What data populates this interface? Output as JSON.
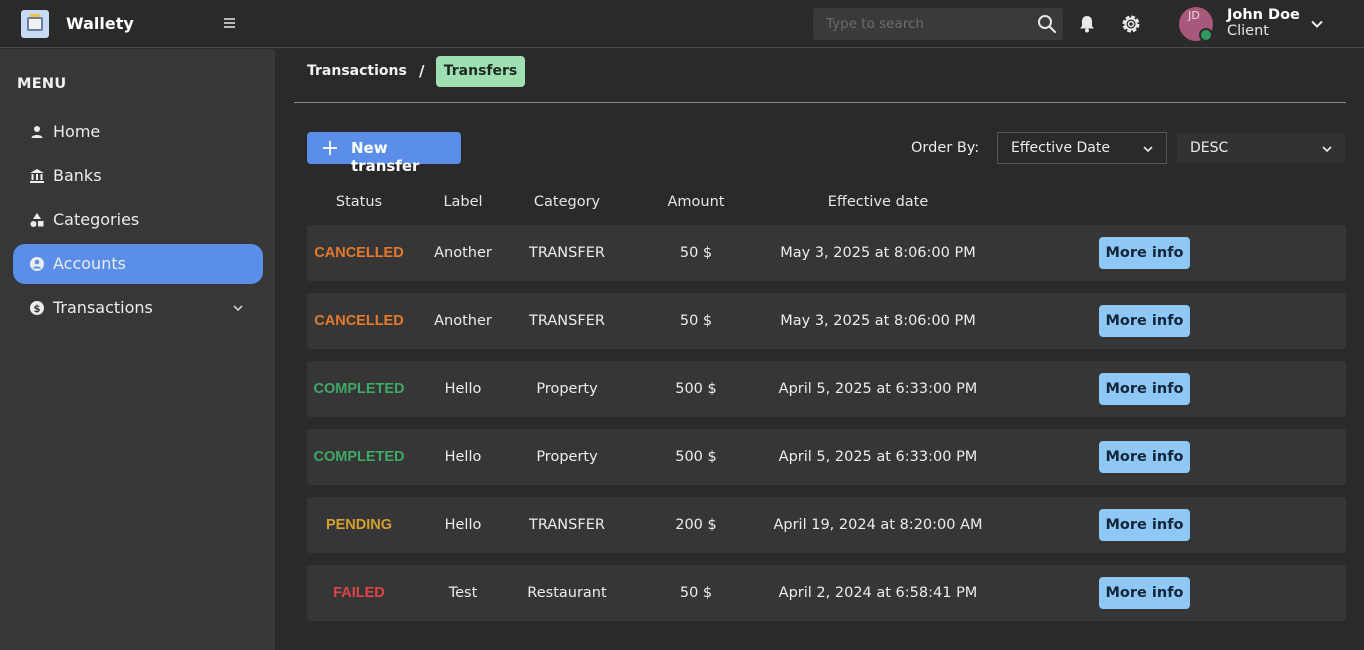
{
  "app": {
    "title": "Wallety"
  },
  "search": {
    "placeholder": "Type to search"
  },
  "user": {
    "initials": "JD",
    "name": "John Doe",
    "role": "Client"
  },
  "sidebar": {
    "header": "MENU",
    "items": [
      {
        "label": "Home",
        "icon": "person-icon",
        "active": false
      },
      {
        "label": "Banks",
        "icon": "bank-icon",
        "active": false
      },
      {
        "label": "Categories",
        "icon": "shapes-icon",
        "active": false
      },
      {
        "label": "Accounts",
        "icon": "account-circle-icon",
        "active": true
      },
      {
        "label": "Transactions",
        "icon": "dollar-circle-icon",
        "active": false,
        "expandable": true
      }
    ]
  },
  "breadcrumb": {
    "parent": "Transactions",
    "separator": "/",
    "current": "Transfers"
  },
  "toolbar": {
    "new_button": "New transfer",
    "order_by_label": "Order By:",
    "order_field": "Effective Date",
    "order_direction": "DESC"
  },
  "table": {
    "columns": [
      "Status",
      "Label",
      "Category",
      "Amount",
      "Effective date"
    ],
    "action_label": "More info",
    "rows": [
      {
        "status": "CANCELLED",
        "label": "Another",
        "category": "TRANSFER",
        "amount": "50 $",
        "date": "May 3, 2025 at 8:06:00 PM"
      },
      {
        "status": "CANCELLED",
        "label": "Another",
        "category": "TRANSFER",
        "amount": "50 $",
        "date": "May 3, 2025 at 8:06:00 PM"
      },
      {
        "status": "COMPLETED",
        "label": "Hello",
        "category": "Property",
        "amount": "500 $",
        "date": "April 5, 2025 at 6:33:00 PM"
      },
      {
        "status": "COMPLETED",
        "label": "Hello",
        "category": "Property",
        "amount": "500 $",
        "date": "April 5, 2025 at 6:33:00 PM"
      },
      {
        "status": "PENDING",
        "label": "Hello",
        "category": "TRANSFER",
        "amount": "200 $",
        "date": "April 19, 2024 at 8:20:00 AM"
      },
      {
        "status": "FAILED",
        "label": "Test",
        "category": "Restaurant",
        "amount": "50 $",
        "date": "April 2, 2024 at 6:58:41 PM"
      }
    ]
  },
  "colors": {
    "accent": "#5b8ee8",
    "status_cancelled": "#e57a2e",
    "status_completed": "#3fa866",
    "status_pending": "#d4a030",
    "status_failed": "#e04545"
  }
}
